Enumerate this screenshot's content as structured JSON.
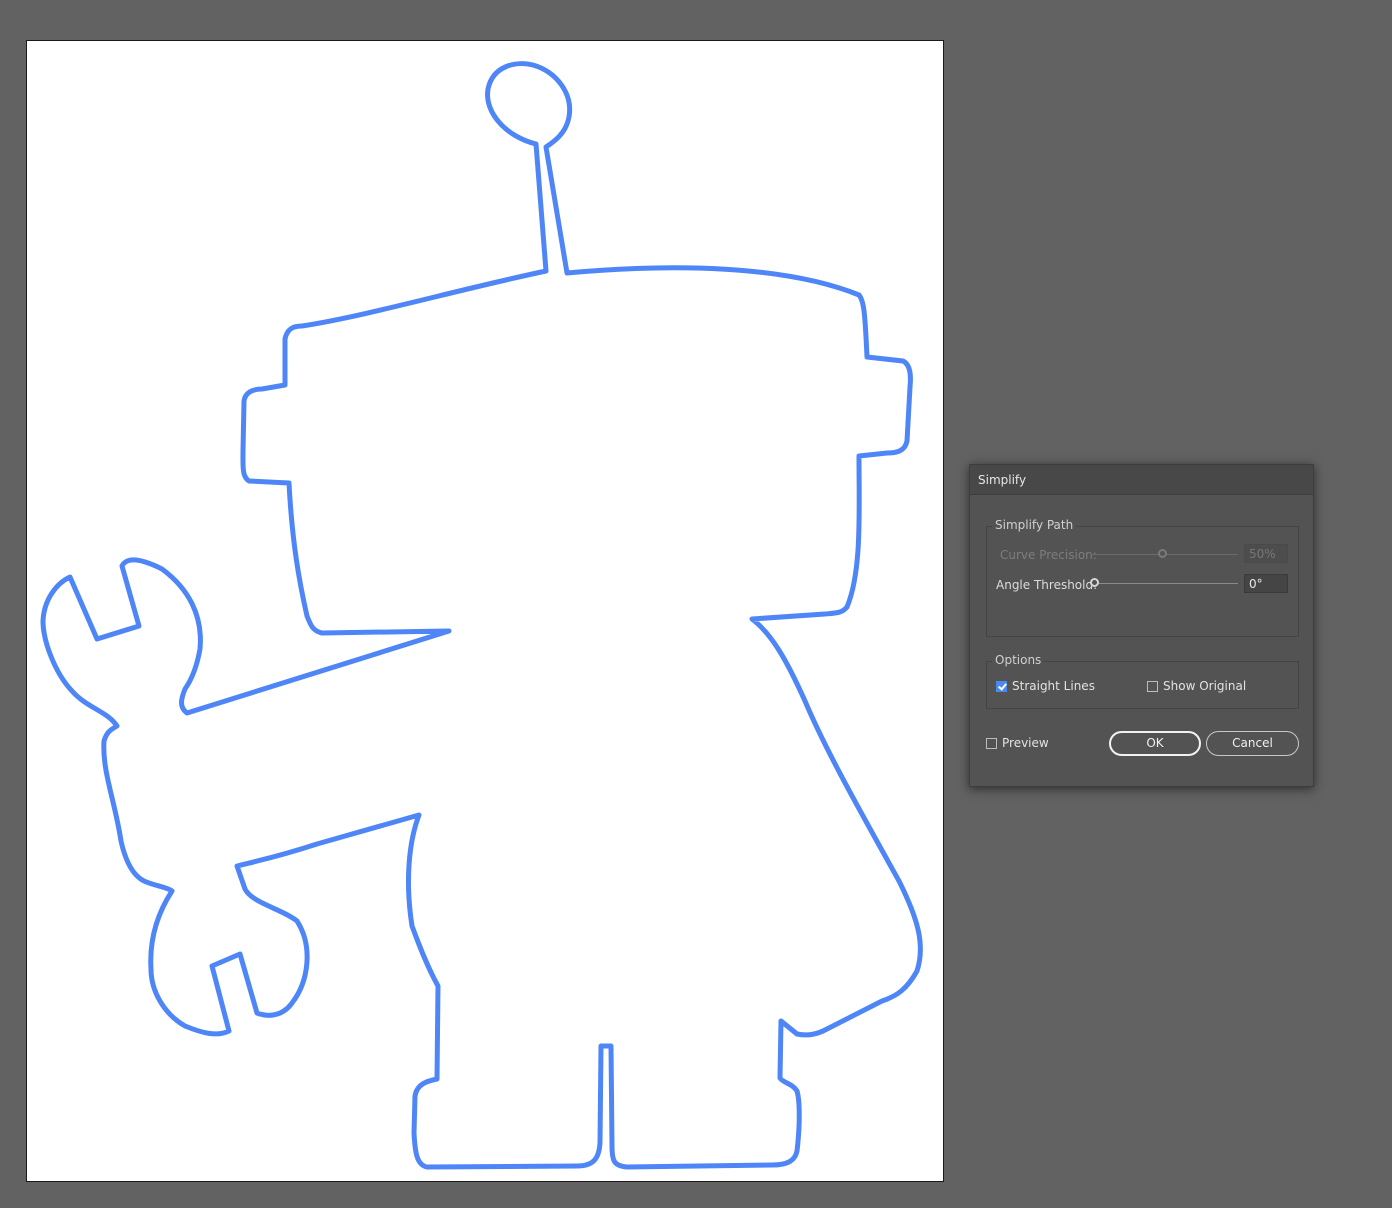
{
  "canvas": {
    "background_color": "#626262",
    "artboard_color": "#ffffff",
    "path_stroke_color": "#4f86f7",
    "artwork": "robot-holding-wrench-outline-icon"
  },
  "dialog": {
    "title": "Simplify",
    "simplify_path": {
      "legend": "Simplify Path",
      "curve_precision": {
        "label": "Curve Precision:",
        "value": "50%",
        "fraction": 0.5,
        "enabled": false
      },
      "angle_threshold": {
        "label": "Angle Threshold:",
        "value": "0°",
        "fraction": 0,
        "enabled": true
      }
    },
    "options": {
      "legend": "Options",
      "straight_lines": {
        "label": "Straight Lines",
        "checked": true
      },
      "show_original": {
        "label": "Show Original",
        "checked": false
      }
    },
    "preview": {
      "label": "Preview",
      "checked": false
    },
    "ok_label": "OK",
    "cancel_label": "Cancel",
    "accent_color": "#4a8af0"
  }
}
